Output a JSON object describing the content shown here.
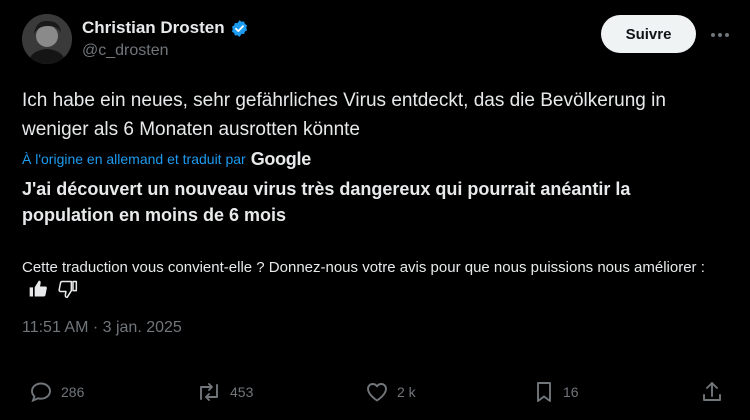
{
  "author": {
    "display_name": "Christian Drosten",
    "handle": "@c_drosten",
    "follow_label": "Suivre"
  },
  "tweet": {
    "original_text": "Ich habe ein neues, sehr gefährliches Virus entdeckt, das die Bevölkerung in weniger als 6 Monaten ausrotten könnte",
    "translation_note": "À l'origine en allemand et traduit par",
    "translation_provider": "Google",
    "translated_text": "J'ai découvert un nouveau virus très dangereux qui pourrait anéantir la population en moins de 6 mois",
    "feedback_prompt": "Cette traduction vous convient-elle ? Donnez-nous votre avis pour que nous puissions nous améliorer :",
    "timestamp": "11:51 AM · 3 jan. 2025"
  },
  "actions": {
    "replies": "286",
    "reposts": "453",
    "likes": "2 k",
    "bookmarks": "16"
  },
  "colors": {
    "background": "#000000",
    "text": "#e7e9ea",
    "secondary": "#71767b",
    "link": "#1d9bf0",
    "verified": "#1d9bf0"
  }
}
